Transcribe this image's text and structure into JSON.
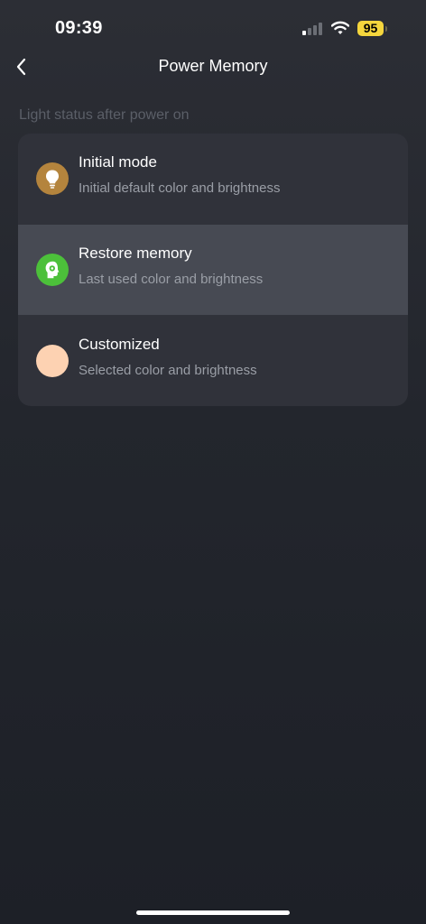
{
  "status_bar": {
    "time": "09:39",
    "battery_level": "95",
    "signal_bars_active": 1,
    "signal_bars_total": 4
  },
  "nav": {
    "title": "Power Memory",
    "back_icon": "chevron-left-icon"
  },
  "section": {
    "label": "Light status after power on"
  },
  "options": [
    {
      "title": "Initial mode",
      "subtitle": "Initial default color and brightness",
      "icon": "lightbulb-icon",
      "icon_color": "#b4843d",
      "selected": false
    },
    {
      "title": "Restore memory",
      "subtitle": "Last used color and brightness",
      "icon": "memory-head-icon",
      "icon_color": "#4cc03a",
      "selected": true
    },
    {
      "title": "Customized",
      "subtitle": "Selected color and brightness",
      "icon": "color-swatch-icon",
      "icon_color": "#fdd2b2",
      "selected": false
    }
  ],
  "colors": {
    "background": "#25282f",
    "card": "#30323a",
    "selected_row": "#474a53",
    "battery": "#f5d63d"
  }
}
